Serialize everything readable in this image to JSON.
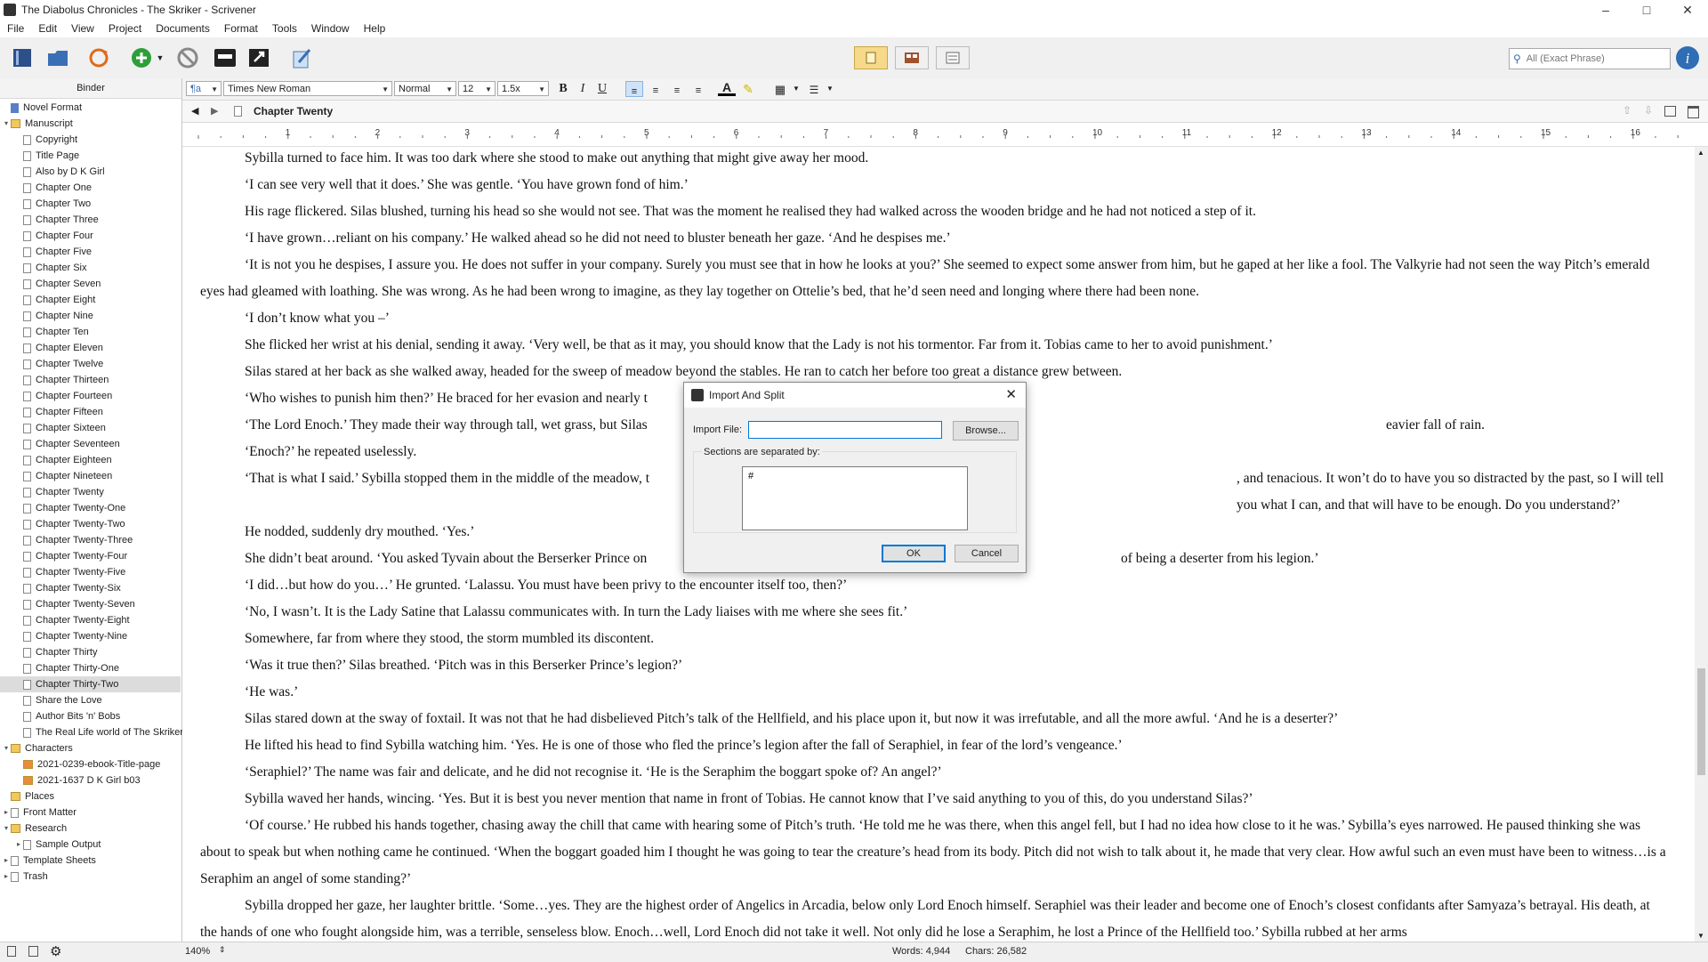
{
  "window": {
    "title": "The Diabolus Chronicles - The Skriker - Scrivener"
  },
  "menu": [
    "File",
    "Edit",
    "View",
    "Project",
    "Documents",
    "Format",
    "Tools",
    "Window",
    "Help"
  ],
  "search": {
    "placeholder": "All (Exact Phrase)"
  },
  "binder": {
    "header": "Binder",
    "items": [
      {
        "label": "Novel Format",
        "kind": "format",
        "indent": 0
      },
      {
        "label": "Manuscript",
        "kind": "folder",
        "indent": 0,
        "twisty": "open"
      },
      {
        "label": "Copyright",
        "kind": "doc",
        "indent": 1
      },
      {
        "label": "Title Page",
        "kind": "doc",
        "indent": 1
      },
      {
        "label": "Also by D K Girl",
        "kind": "doc",
        "indent": 1
      },
      {
        "label": "Chapter One",
        "kind": "doc",
        "indent": 1
      },
      {
        "label": "Chapter Two",
        "kind": "doc",
        "indent": 1
      },
      {
        "label": "Chapter Three",
        "kind": "doc",
        "indent": 1
      },
      {
        "label": "Chapter Four",
        "kind": "doc",
        "indent": 1
      },
      {
        "label": "Chapter Five",
        "kind": "doc",
        "indent": 1
      },
      {
        "label": "Chapter Six",
        "kind": "doc",
        "indent": 1
      },
      {
        "label": "Chapter Seven",
        "kind": "doc",
        "indent": 1
      },
      {
        "label": "Chapter Eight",
        "kind": "doc",
        "indent": 1
      },
      {
        "label": "Chapter Nine",
        "kind": "doc",
        "indent": 1
      },
      {
        "label": "Chapter Ten",
        "kind": "doc",
        "indent": 1
      },
      {
        "label": "Chapter Eleven",
        "kind": "doc",
        "indent": 1
      },
      {
        "label": "Chapter Twelve",
        "kind": "doc",
        "indent": 1
      },
      {
        "label": "Chapter Thirteen",
        "kind": "doc",
        "indent": 1
      },
      {
        "label": "Chapter Fourteen",
        "kind": "doc",
        "indent": 1
      },
      {
        "label": "Chapter Fifteen",
        "kind": "doc",
        "indent": 1
      },
      {
        "label": "Chapter Sixteen",
        "kind": "doc",
        "indent": 1
      },
      {
        "label": "Chapter Seventeen",
        "kind": "doc",
        "indent": 1
      },
      {
        "label": "Chapter Eighteen",
        "kind": "doc",
        "indent": 1
      },
      {
        "label": "Chapter Nineteen",
        "kind": "doc",
        "indent": 1
      },
      {
        "label": "Chapter Twenty",
        "kind": "doc",
        "indent": 1
      },
      {
        "label": "Chapter Twenty-One",
        "kind": "doc",
        "indent": 1
      },
      {
        "label": "Chapter Twenty-Two",
        "kind": "doc",
        "indent": 1
      },
      {
        "label": "Chapter Twenty-Three",
        "kind": "doc",
        "indent": 1
      },
      {
        "label": "Chapter Twenty-Four",
        "kind": "doc",
        "indent": 1
      },
      {
        "label": "Chapter Twenty-Five",
        "kind": "doc",
        "indent": 1
      },
      {
        "label": "Chapter Twenty-Six",
        "kind": "doc",
        "indent": 1
      },
      {
        "label": "Chapter Twenty-Seven",
        "kind": "doc",
        "indent": 1
      },
      {
        "label": "Chapter Twenty-Eight",
        "kind": "doc",
        "indent": 1
      },
      {
        "label": "Chapter Twenty-Nine",
        "kind": "doc",
        "indent": 1
      },
      {
        "label": "Chapter Thirty",
        "kind": "doc",
        "indent": 1
      },
      {
        "label": "Chapter Thirty-One",
        "kind": "doc",
        "indent": 1
      },
      {
        "label": "Chapter Thirty-Two",
        "kind": "doc",
        "indent": 1,
        "selected": true
      },
      {
        "label": "Share the Love",
        "kind": "doc",
        "indent": 1
      },
      {
        "label": "Author Bits 'n' Bobs",
        "kind": "doc",
        "indent": 1
      },
      {
        "label": "The Real Life world of The Skriker",
        "kind": "doc",
        "indent": 1
      },
      {
        "label": "Characters",
        "kind": "folder",
        "indent": 0,
        "twisty": "open"
      },
      {
        "label": "2021-0239-ebook-Title-page",
        "kind": "image",
        "indent": 1
      },
      {
        "label": "2021-1637 D K Girl b03",
        "kind": "image",
        "indent": 1
      },
      {
        "label": "Places",
        "kind": "folder",
        "indent": 0
      },
      {
        "label": "Front Matter",
        "kind": "doc",
        "indent": 0,
        "twisty": "closed"
      },
      {
        "label": "Research",
        "kind": "folder",
        "indent": 0,
        "twisty": "open"
      },
      {
        "label": "Sample Output",
        "kind": "doc",
        "indent": 1,
        "twisty": "closed"
      },
      {
        "label": "Template Sheets",
        "kind": "doc",
        "indent": 0,
        "twisty": "closed"
      },
      {
        "label": "Trash",
        "kind": "doc",
        "indent": 0,
        "twisty": "closed"
      }
    ]
  },
  "format": {
    "font": "Times New Roman",
    "style": "Normal",
    "size": "12",
    "spacing": "1.5x"
  },
  "document": {
    "title": "Chapter Twenty",
    "paragraphs": [
      "Sybilla turned to face him. It was too dark where she stood to make out anything that might give away her mood.",
      "‘I can see very well that it does.’ She was gentle. ‘You have grown fond of him.’",
      "His rage flickered. Silas blushed, turning his head so she would not see. That was the moment he realised they had walked across the wooden bridge and he had not noticed a step of it.",
      "‘I have grown…reliant on his company.’ He walked ahead so he did not need to bluster beneath her gaze. ‘And he despises me.’",
      "‘It is not you he despises, I assure you. He does not suffer in your company. Surely you must see that in how he looks at you?’ She seemed to expect some answer from him, but he gaped at her like a fool. The Valkyrie had not seen the way Pitch’s emerald eyes had gleamed with loathing. She was wrong. As he had been wrong to imagine, as they lay together on Ottelie’s bed, that he’d seen need and longing where there had been none.",
      "‘I don’t know what you –’",
      "She flicked her wrist at his denial, sending it away. ‘Very well, be that as it may, you should know that the Lady is not his tormentor. Far from it. Tobias came to her to avoid punishment.’",
      "Silas stared at her back as she walked away, headed for the sweep of meadow beyond the stables. He ran to catch her before too great a distance grew between.",
      "‘Who wishes to punish him then?’ He braced for her evasion and nearly t",
      "‘The Lord Enoch.’ They made their way through tall, wet grass, but Silas",
      "‘Enoch?’ he repeated uselessly.",
      "‘That is what I said.’ Sybilla stopped them in the middle of the meadow, t",
      "He nodded, suddenly dry mouthed. ‘Yes.’",
      "She didn’t beat around. ‘You asked Tyvain about the Berserker Prince on",
      "‘I did…but how do you…’ He grunted. ‘Lalassu. You must have been privy to the encounter itself too, then?’",
      "‘No, I wasn’t. It is the Lady Satine that Lalassu communicates with. In turn the Lady liaises with me where she sees fit.’",
      "Somewhere, far from where they stood, the storm mumbled its discontent.",
      "‘Was it true then?’ Silas breathed. ‘Pitch was in this Berserker Prince’s legion?’",
      "‘He was.’",
      "Silas stared down at the sway of foxtail. It was not that he had disbelieved Pitch’s talk of the Hellfield, and his place upon it, but now it was irrefutable, and all the more awful. ‘And he is a deserter?’",
      "He lifted his head to find Sybilla watching him. ‘Yes. He is one of those who fled the prince’s legion after the fall of Seraphiel, in fear of the lord’s vengeance.’",
      "‘Seraphiel?’ The name was fair and delicate, and he did not recognise it. ‘He is the Seraphim the boggart spoke of? An angel?’",
      "Sybilla waved her hands, wincing. ‘Yes. But it is best you never mention that name in front of Tobias. He cannot know that I’ve said anything to you of this, do you understand Silas?’",
      "‘Of course.’ He rubbed his hands together, chasing away the chill that came with hearing some of Pitch’s truth. ‘He told me he was there, when this angel fell, but I had no idea how close to it he was.’ Sybilla’s eyes narrowed. He paused thinking she was about to speak but when nothing came he continued. ‘When the boggart goaded him I thought he was going to tear the creature’s head from its body. Pitch did not wish to talk about it, he made that very clear. How awful such an even must have been to witness…is a Seraphim an angel of some standing?’",
      "Sybilla dropped her gaze, her laughter brittle. ‘Some…yes. They are the highest order of Angelics in Arcadia, below only Lord Enoch himself. Seraphiel was their leader and become one of Enoch’s closest confidants after Samyaza’s betrayal. His death, at the hands of one who fought alongside him, was a terrible, senseless blow. Enoch…well, Lord Enoch did not take it well. Not only did he lose a Seraphim, he lost a Prince of the Hellfield too.’ Sybilla rubbed at her arms"
    ],
    "right_fragments": [
      {
        "para": 9,
        "text": "eavier fall of rain."
      },
      {
        "para": 11,
        "text": ", and tenacious. It won’t do to have you so distracted by the past, so I will tell you what I can, and that will have to be enough. Do you understand?’"
      },
      {
        "para": 13,
        "text": "of being a deserter from his legion.’"
      }
    ]
  },
  "statusbar": {
    "zoom": "140%",
    "words": "Words: 4,944",
    "chars": "Chars: 26,582"
  },
  "dialog": {
    "title": "Import And Split",
    "import_label": "Import File:",
    "import_value": "",
    "browse": "Browse...",
    "separator_label": "Sections are separated by:",
    "separator_value": "#",
    "ok": "OK",
    "cancel": "Cancel"
  }
}
